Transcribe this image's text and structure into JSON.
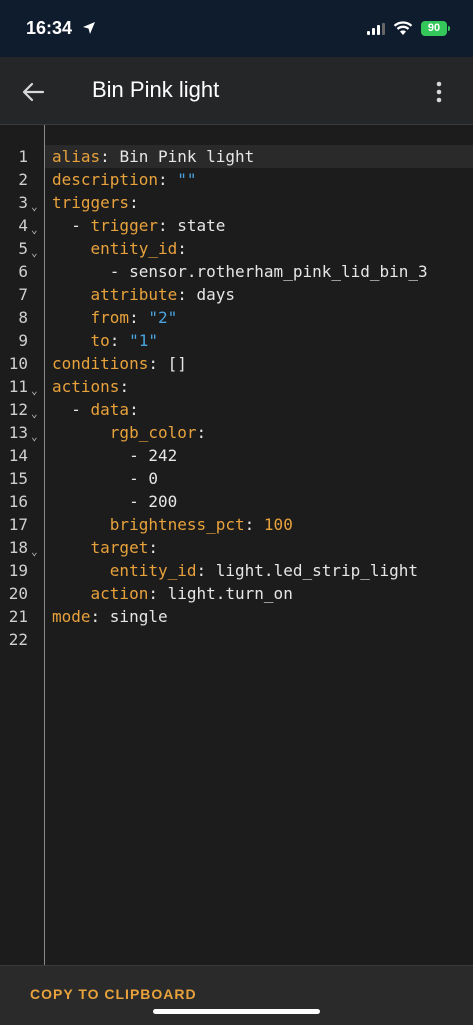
{
  "status_bar": {
    "time": "16:34",
    "battery": "90"
  },
  "app_bar": {
    "title": "Bin Pink light"
  },
  "editor": {
    "line_numbers": [
      "1",
      "2",
      "3",
      "4",
      "5",
      "6",
      "7",
      "8",
      "9",
      "10",
      "11",
      "12",
      "13",
      "14",
      "15",
      "16",
      "17",
      "18",
      "19",
      "20",
      "21",
      "22"
    ],
    "fold_lines": [
      3,
      4,
      5,
      11,
      12,
      13,
      18
    ],
    "lines": [
      {
        "indent": "",
        "key": "alias",
        "sep": ": ",
        "value": "Bin Pink light",
        "vtype": "plain"
      },
      {
        "indent": "",
        "key": "description",
        "sep": ": ",
        "value": "\"\"",
        "vtype": "string"
      },
      {
        "indent": "",
        "key": "triggers",
        "sep": ":",
        "value": "",
        "vtype": "plain"
      },
      {
        "indent": "  - ",
        "key": "trigger",
        "sep": ": ",
        "value": "state",
        "vtype": "plain"
      },
      {
        "indent": "    ",
        "key": "entity_id",
        "sep": ":",
        "value": "",
        "vtype": "plain"
      },
      {
        "indent": "      - ",
        "key": "",
        "sep": "",
        "value": "sensor.rotherham_pink_lid_bin_3",
        "vtype": "plain"
      },
      {
        "indent": "    ",
        "key": "attribute",
        "sep": ": ",
        "value": "days",
        "vtype": "plain"
      },
      {
        "indent": "    ",
        "key": "from",
        "sep": ": ",
        "value": "\"2\"",
        "vtype": "string"
      },
      {
        "indent": "    ",
        "key": "to",
        "sep": ": ",
        "value": "\"1\"",
        "vtype": "string"
      },
      {
        "indent": "",
        "key": "conditions",
        "sep": ": ",
        "value": "[]",
        "vtype": "plain"
      },
      {
        "indent": "",
        "key": "actions",
        "sep": ":",
        "value": "",
        "vtype": "plain"
      },
      {
        "indent": "  - ",
        "key": "data",
        "sep": ":",
        "value": "",
        "vtype": "plain"
      },
      {
        "indent": "      ",
        "key": "rgb_color",
        "sep": ":",
        "value": "",
        "vtype": "plain"
      },
      {
        "indent": "        - ",
        "key": "",
        "sep": "",
        "value": "242",
        "vtype": "plain"
      },
      {
        "indent": "        - ",
        "key": "",
        "sep": "",
        "value": "0",
        "vtype": "plain"
      },
      {
        "indent": "        - ",
        "key": "",
        "sep": "",
        "value": "200",
        "vtype": "plain"
      },
      {
        "indent": "      ",
        "key": "brightness_pct",
        "sep": ": ",
        "value": "100",
        "vtype": "number"
      },
      {
        "indent": "    ",
        "key": "target",
        "sep": ":",
        "value": "",
        "vtype": "plain"
      },
      {
        "indent": "      ",
        "key": "entity_id",
        "sep": ": ",
        "value": "light.led_strip_light",
        "vtype": "plain"
      },
      {
        "indent": "    ",
        "key": "action",
        "sep": ": ",
        "value": "light.turn_on",
        "vtype": "plain"
      },
      {
        "indent": "",
        "key": "mode",
        "sep": ": ",
        "value": "single",
        "vtype": "plain"
      },
      {
        "indent": "",
        "key": "",
        "sep": "",
        "value": "",
        "vtype": "plain"
      }
    ]
  },
  "bottom": {
    "copy_label": "COPY TO CLIPBOARD"
  },
  "colors": {
    "key": "#e8a23c",
    "string": "#4aa3df",
    "background": "#1c1c1c"
  },
  "icons": {
    "back": "arrow-left-icon",
    "more": "more-vertical-icon",
    "fold": "chevron-down-icon"
  }
}
